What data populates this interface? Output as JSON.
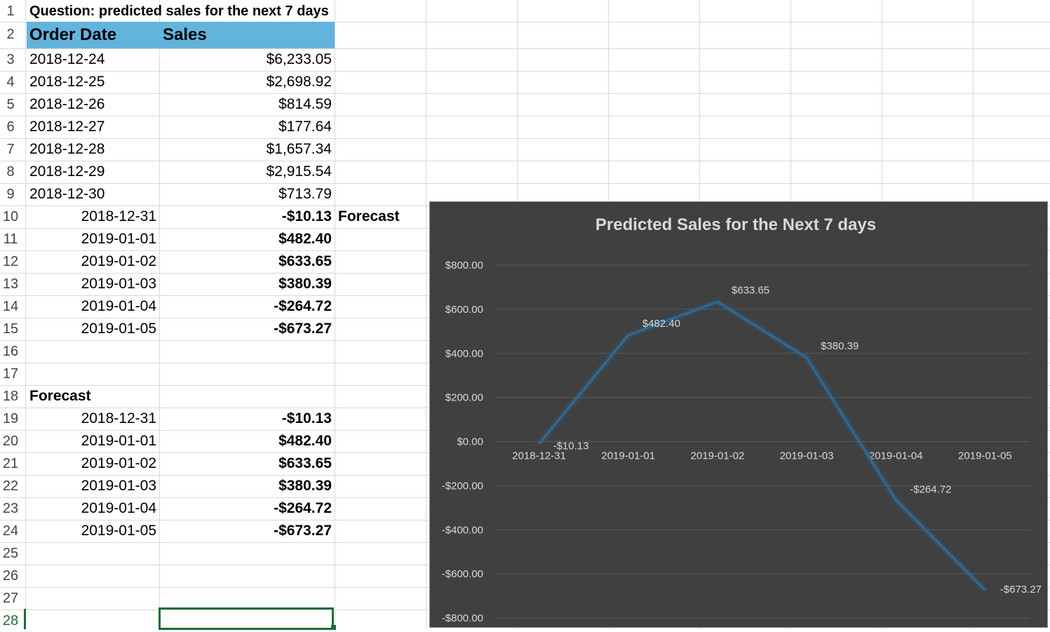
{
  "sheet": {
    "question": "Question: predicted sales for the next 7 days",
    "headers": {
      "order_date": "Order Date",
      "sales": "Sales"
    },
    "history": [
      {
        "date": "2018-12-24",
        "sales": "$6,233.05"
      },
      {
        "date": "2018-12-25",
        "sales": "$2,698.92"
      },
      {
        "date": "2018-12-26",
        "sales": "$814.59"
      },
      {
        "date": "2018-12-27",
        "sales": "$177.64"
      },
      {
        "date": "2018-12-28",
        "sales": "$1,657.34"
      },
      {
        "date": "2018-12-29",
        "sales": "$2,915.54"
      },
      {
        "date": "2018-12-30",
        "sales": "$713.79"
      }
    ],
    "forecast_inline": [
      {
        "date": "2018-12-31",
        "sales": "-$10.13"
      },
      {
        "date": "2019-01-01",
        "sales": "$482.40"
      },
      {
        "date": "2019-01-02",
        "sales": "$633.65"
      },
      {
        "date": "2019-01-03",
        "sales": "$380.39"
      },
      {
        "date": "2019-01-04",
        "sales": "-$264.72"
      },
      {
        "date": "2019-01-05",
        "sales": "-$673.27"
      }
    ],
    "forecast_note": "Forecast",
    "forecast_title": "Forecast",
    "forecast_table": [
      {
        "date": "2018-12-31",
        "sales": "-$10.13"
      },
      {
        "date": "2019-01-01",
        "sales": "$482.40"
      },
      {
        "date": "2019-01-02",
        "sales": "$633.65"
      },
      {
        "date": "2019-01-03",
        "sales": "$380.39"
      },
      {
        "date": "2019-01-04",
        "sales": "-$264.72"
      },
      {
        "date": "2019-01-05",
        "sales": "-$673.27"
      }
    ],
    "row_numbers": [
      "1",
      "2",
      "3",
      "4",
      "5",
      "6",
      "7",
      "8",
      "9",
      "10",
      "11",
      "12",
      "13",
      "14",
      "15",
      "16",
      "17",
      "18",
      "19",
      "20",
      "21",
      "22",
      "23",
      "24",
      "25",
      "26",
      "27",
      "28"
    ],
    "selected_row": "28"
  },
  "chart_data": {
    "type": "line",
    "title": "Predicted Sales for the Next 7 days",
    "categories": [
      "2018-12-31",
      "2019-01-01",
      "2019-01-02",
      "2019-01-03",
      "2019-01-04",
      "2019-01-05"
    ],
    "values": [
      -10.13,
      482.4,
      633.65,
      380.39,
      -264.72,
      -673.27
    ],
    "data_labels": [
      "-$10.13",
      "$482.40",
      "$633.65",
      "$380.39",
      "-$264.72",
      "-$673.27"
    ],
    "y_ticks": [
      "$800.00",
      "$600.00",
      "$400.00",
      "$200.00",
      "$0.00",
      "-$200.00",
      "-$400.00",
      "-$600.00",
      "-$800.00"
    ],
    "ylim": [
      -800,
      800
    ],
    "grid": true,
    "colors": {
      "background": "#404040",
      "line": "#2e6a96",
      "text": "#d9d9d9",
      "gridline": "#595959"
    }
  }
}
